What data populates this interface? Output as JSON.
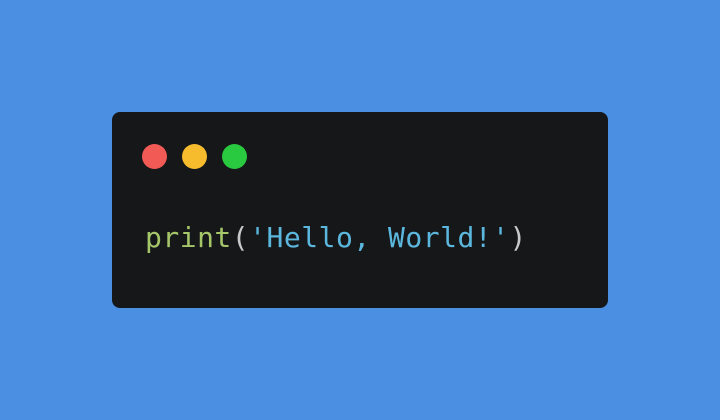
{
  "window": {
    "traffic_lights": [
      {
        "name": "close",
        "color": "#f25a56"
      },
      {
        "name": "minimize",
        "color": "#f7bc2e"
      },
      {
        "name": "maximize",
        "color": "#29c940"
      }
    ]
  },
  "code": {
    "function": "print",
    "open_paren": "(",
    "string": "'Hello, World!'",
    "close_paren": ")",
    "colors": {
      "function": "#a6c66a",
      "paren": "#c9c9c9",
      "string": "#5bb7dd",
      "background": "#161719",
      "page_background": "#4a8fe2"
    }
  }
}
